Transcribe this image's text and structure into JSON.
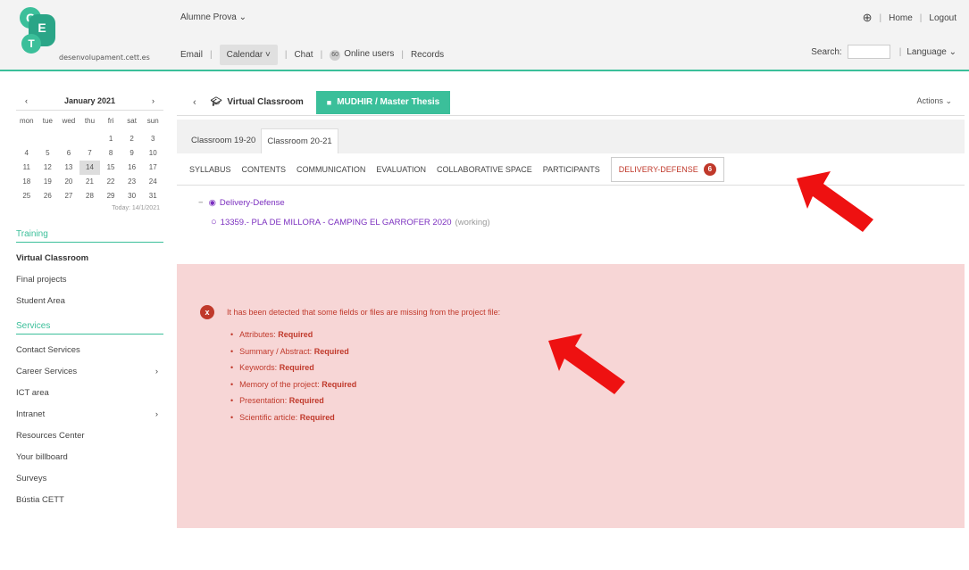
{
  "header": {
    "logo_letters": [
      "C",
      "E",
      "T"
    ],
    "domain": "desenvolupament.cett.es",
    "user": "Alumne Prova",
    "nav": {
      "email": "Email",
      "calendar": "Calendar",
      "chat": "Chat",
      "online_count": "60",
      "online_users": "Online users",
      "records": "Records"
    },
    "right": {
      "home": "Home",
      "logout": "Logout",
      "search_label": "Search:",
      "language": "Language"
    }
  },
  "calendar": {
    "title": "January 2021",
    "weekdays": [
      "mon",
      "tue",
      "wed",
      "thu",
      "fri",
      "sat",
      "sun"
    ],
    "days": [
      "",
      "",
      "",
      "",
      "1",
      "2",
      "3",
      "4",
      "5",
      "6",
      "7",
      "8",
      "9",
      "10",
      "11",
      "12",
      "13",
      "14",
      "15",
      "16",
      "17",
      "18",
      "19",
      "20",
      "21",
      "22",
      "23",
      "24",
      "25",
      "26",
      "27",
      "28",
      "29",
      "30",
      "31"
    ],
    "today": "14",
    "today_label": "Today: 14/1/2021"
  },
  "sidebar": {
    "training_title": "Training",
    "training_items": [
      "Virtual Classroom",
      "Final projects",
      "Student Area"
    ],
    "services_title": "Services",
    "services_items": [
      {
        "label": "Contact Services",
        "chevron": false
      },
      {
        "label": "Career Services",
        "chevron": true
      },
      {
        "label": "ICT area",
        "chevron": false
      },
      {
        "label": "Intranet",
        "chevron": true
      },
      {
        "label": "Resources Center",
        "chevron": false
      },
      {
        "label": "Your billboard",
        "chevron": false
      },
      {
        "label": "Surveys",
        "chevron": false
      },
      {
        "label": "Bústia CETT",
        "chevron": false
      }
    ]
  },
  "main": {
    "breadcrumb_vc": "Virtual Classroom",
    "breadcrumb_thesis": "MUDHIR / Master Thesis",
    "actions": "Actions",
    "class_tabs": [
      "Classroom 19-20",
      "Classroom 20-21"
    ],
    "menu": [
      "SYLLABUS",
      "CONTENTS",
      "COMMUNICATION",
      "EVALUATION",
      "COLLABORATIVE SPACE",
      "PARTICIPANTS"
    ],
    "menu_selected": "DELIVERY-DEFENSE",
    "menu_selected_count": "6",
    "tree_folder": "Delivery-Defense",
    "tree_project": "13359.- PLA DE MILLORA - CAMPING EL GARROFER 2020",
    "tree_project_status": "(working)"
  },
  "alert": {
    "message": "It has been detected that some fields or files are missing from the project file:",
    "items": [
      {
        "field": "Attributes:",
        "status": "Required"
      },
      {
        "field": "Summary / Abstract:",
        "status": "Required"
      },
      {
        "field": "Keywords:",
        "status": "Required"
      },
      {
        "field": "Memory of the project:",
        "status": "Required"
      },
      {
        "field": "Presentation:",
        "status": "Required"
      },
      {
        "field": "Scientific article:",
        "status": "Required"
      }
    ]
  },
  "colors": {
    "accent": "#3bbf9a",
    "alert_bg": "#f7d6d6",
    "alert_text": "#c0392b",
    "link_purple": "#7b2fbf",
    "arrow_red": "#ee1111"
  }
}
